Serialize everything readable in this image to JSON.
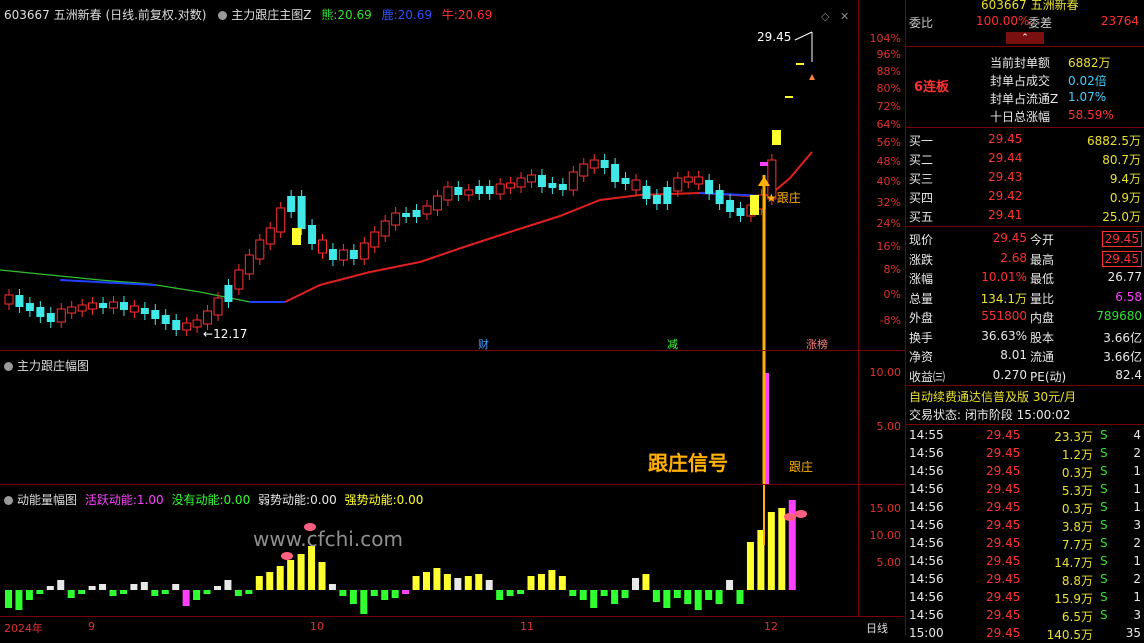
{
  "chart_header": {
    "stock": "603667 五洲新春 (日线.前复权.对数)",
    "indicator": "主力跟庄主图Z",
    "l1_label": "熊:",
    "l1_value": "20.69",
    "l2_label": "鹿:",
    "l2_value": "20.69",
    "l3_label": "牛:",
    "l3_value": "20.69"
  },
  "main_axis": [
    "104%",
    "96%",
    "88%",
    "80%",
    "72%",
    "64%",
    "56%",
    "48%",
    "40%",
    "32%",
    "24%",
    "16%",
    "8%",
    "0%",
    "-8%"
  ],
  "annotations": {
    "high": "29.45",
    "low": "12.17",
    "follow": "跟庄",
    "markers": [
      "财",
      "减",
      "涨榜"
    ]
  },
  "panel2": {
    "title": "主力跟庄幅图",
    "axis": [
      "10.00",
      "5.00"
    ],
    "signal_text": "跟庄信号",
    "follow": "跟庄"
  },
  "panel3": {
    "title": "动能量幅图",
    "a_label": "活跃动能:",
    "a_value": "1.00",
    "b_label": "没有动能:",
    "b_value": "0.00",
    "c_label": "弱势动能:",
    "c_value": "0.00",
    "d_label": "强势动能:",
    "d_value": "0.00",
    "axis": [
      "15.00",
      "10.00",
      "5.00"
    ],
    "watermark": "www.cfchi.com"
  },
  "date_axis": {
    "year": "2024年",
    "m9": "9",
    "m10": "10",
    "m11": "11",
    "m12": "12",
    "period": "日线"
  },
  "quote": {
    "code_title": "603667 五洲新春",
    "weibi_label": "委比",
    "weibi_value": "100.00%",
    "weicha_label": "委差",
    "weicha_value": "23764",
    "streak": "6连板",
    "seal_label": "当前封单额",
    "seal_value": "6882万",
    "seal_deal_label": "封单占成交",
    "seal_deal_value": "0.02倍",
    "seal_float_label": "封单占流通Z",
    "seal_float_value": "1.07%",
    "ten_day_label": "十日总涨幅",
    "ten_day_value": "58.59%",
    "bids": [
      {
        "name": "买一",
        "price": "29.45",
        "vol": "6882.5万"
      },
      {
        "name": "买二",
        "price": "29.44",
        "vol": "80.7万"
      },
      {
        "name": "买三",
        "price": "29.43",
        "vol": "9.4万"
      },
      {
        "name": "买四",
        "price": "29.42",
        "vol": "0.9万"
      },
      {
        "name": "买五",
        "price": "29.41",
        "vol": "25.0万"
      }
    ],
    "stats": [
      {
        "l1": "现价",
        "v1": "29.45",
        "l2": "今开",
        "v2": "29.45"
      },
      {
        "l1": "涨跌",
        "v1": "2.68",
        "l2": "最高",
        "v2": "29.45"
      },
      {
        "l1": "涨幅",
        "v1": "10.01%",
        "l2": "最低",
        "v2": "26.77"
      },
      {
        "l1": "总量",
        "v1": "134.1万",
        "l2": "量比",
        "v2": "6.58"
      },
      {
        "l1": "外盘",
        "v1": "551800",
        "l2": "内盘",
        "v2": "789680"
      },
      {
        "l1": "换手",
        "v1": "36.63%",
        "l2": "股本",
        "v2": "3.66亿"
      },
      {
        "l1": "净资",
        "v1": "8.01",
        "l2": "流通",
        "v2": "3.66亿"
      },
      {
        "l1": "收益㈢",
        "v1": "0.270",
        "l2": "PE(动)",
        "v2": "82.4"
      }
    ],
    "promo": "自动续费通达信普及版  30元/月",
    "status": "交易状态: 闭市阶段 15:00:02",
    "ticks": [
      {
        "t": "14:55",
        "p": "29.45",
        "v": "23.3万",
        "s": "S",
        "n": "4"
      },
      {
        "t": "14:56",
        "p": "29.45",
        "v": "1.2万",
        "s": "S",
        "n": "2"
      },
      {
        "t": "14:56",
        "p": "29.45",
        "v": "0.3万",
        "s": "S",
        "n": "1"
      },
      {
        "t": "14:56",
        "p": "29.45",
        "v": "5.3万",
        "s": "S",
        "n": "1"
      },
      {
        "t": "14:56",
        "p": "29.45",
        "v": "0.3万",
        "s": "S",
        "n": "1"
      },
      {
        "t": "14:56",
        "p": "29.45",
        "v": "3.8万",
        "s": "S",
        "n": "3"
      },
      {
        "t": "14:56",
        "p": "29.45",
        "v": "7.7万",
        "s": "S",
        "n": "2"
      },
      {
        "t": "14:56",
        "p": "29.45",
        "v": "14.7万",
        "s": "S",
        "n": "1"
      },
      {
        "t": "14:56",
        "p": "29.45",
        "v": "8.8万",
        "s": "S",
        "n": "2"
      },
      {
        "t": "14:56",
        "p": "29.45",
        "v": "15.9万",
        "s": "S",
        "n": "1"
      },
      {
        "t": "14:56",
        "p": "29.45",
        "v": "6.5万",
        "s": "S",
        "n": "3"
      },
      {
        "t": "15:00",
        "p": "29.45",
        "v": "140.5万",
        "s": "",
        "n": "35"
      }
    ]
  },
  "colors": {
    "up": "#ff3030",
    "down": "#40e0e0",
    "ma": "#e02020",
    "signal": "#ffb000",
    "bar_magenta": "#ff40ff",
    "bar_yellow": "#ffff30",
    "bar_green": "#30ff30"
  }
}
